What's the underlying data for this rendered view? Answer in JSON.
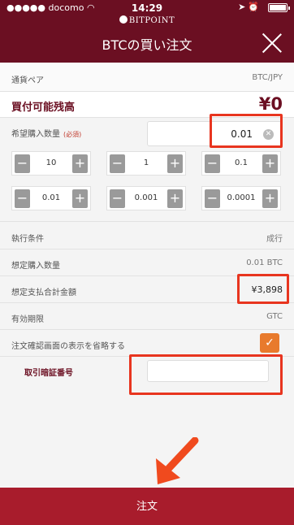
{
  "status_bar": {
    "carrier": "docomo",
    "time": "14:29"
  },
  "header": {
    "logo": "BITPOINT",
    "title": "BTCの買い注文"
  },
  "pair": {
    "label": "通貨ペア",
    "value": "BTC/JPY"
  },
  "balance": {
    "label": "買付可能残高",
    "value": "¥0"
  },
  "quantity": {
    "label": "希望購入数量",
    "required": "(必須)",
    "value": "0.01",
    "steppers": [
      "10",
      "1",
      "0.1",
      "0.01",
      "0.001",
      "0.0001"
    ]
  },
  "execution": {
    "label": "執行条件",
    "value": "成行"
  },
  "est_quantity": {
    "label": "想定購入数量",
    "value": "0.01 BTC"
  },
  "est_payment": {
    "label": "想定支払合計金額",
    "value": "¥3,898"
  },
  "expiry": {
    "label": "有効期限",
    "value": "GTC"
  },
  "skip_confirm": {
    "label": "注文確認画面の表示を省略する",
    "checked": true
  },
  "pin": {
    "label": "取引暗証番号",
    "value": ""
  },
  "order_button": {
    "label": "注文"
  },
  "colors": {
    "brand": "#6b0f22",
    "order_button": "#a81c2c",
    "checkbox": "#e87a2c",
    "highlight": "#e8351f"
  }
}
